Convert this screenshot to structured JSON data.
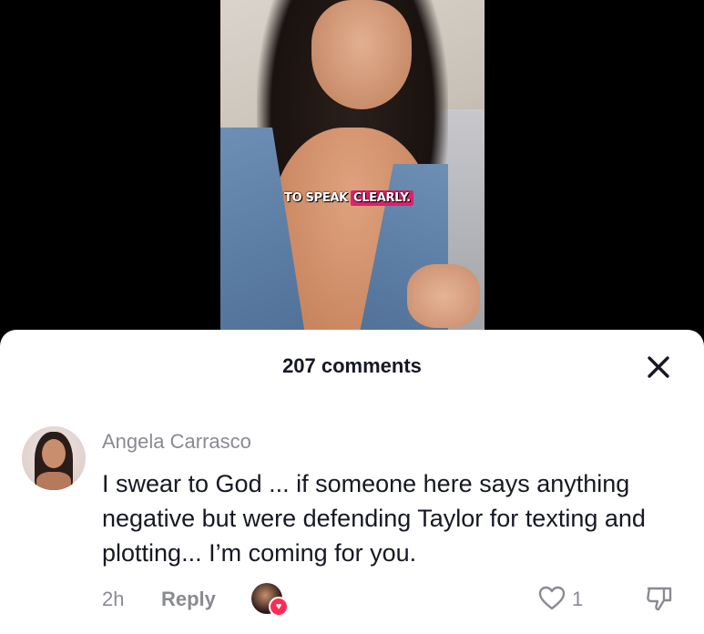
{
  "video": {
    "caption_part1": "TO SPEAK",
    "caption_part2": "CLEARLY."
  },
  "comments_sheet": {
    "title": "207 comments",
    "close_icon": "close-icon"
  },
  "comment": {
    "username": "Angela Carrasco",
    "text": "I swear to God ... if someone here says anything negative but were defending Taylor for texting and plotting... I’m coming for you.",
    "time": "2h",
    "reply_label": "Reply",
    "like_count": "1",
    "icons": [
      "heart-outline-icon",
      "dislike-icon",
      "creator-liked-heart-icon"
    ]
  },
  "colors": {
    "accent_pink": "#fe2c55",
    "caption_highlight": "#d8246a",
    "muted_text": "#8a8b91",
    "primary_text": "#161823"
  }
}
